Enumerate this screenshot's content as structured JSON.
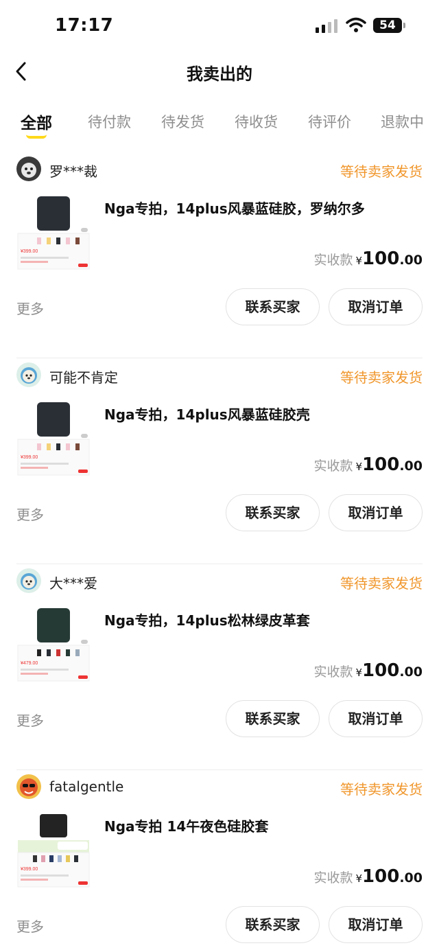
{
  "status_bar": {
    "time": "17:17",
    "battery": "54",
    "icons": [
      "signal-icon",
      "wifi-icon",
      "battery-icon"
    ]
  },
  "nav": {
    "title": "我卖出的",
    "back_icon": "chevron-left-icon"
  },
  "tabs": [
    {
      "label": "全部",
      "active": true
    },
    {
      "label": "待付款",
      "active": false
    },
    {
      "label": "待发货",
      "active": false
    },
    {
      "label": "待收货",
      "active": false
    },
    {
      "label": "待评价",
      "active": false
    },
    {
      "label": "退款中",
      "active": false
    }
  ],
  "colors": {
    "status_orange": "#f0962b",
    "tab_underline": "#ffd91a",
    "muted_gray": "#8e8e8e"
  },
  "orders": [
    {
      "buyer": "罗***裁",
      "status": "等待卖家发货",
      "title": "Nga专拍，14plus风暴蓝硅胶，罗纳尔多",
      "price_label": "实收款",
      "currency": "¥",
      "price_int": "100",
      "price_dec": ".00",
      "thumb_price": "¥399.00",
      "more": "更多",
      "contact": "联系买家",
      "cancel": "取消订单"
    },
    {
      "buyer": "可能不肯定",
      "status": "等待卖家发货",
      "title": "Nga专拍，14plus风暴蓝硅胶壳",
      "price_label": "实收款",
      "currency": "¥",
      "price_int": "100",
      "price_dec": ".00",
      "thumb_price": "¥399.00",
      "more": "更多",
      "contact": "联系买家",
      "cancel": "取消订单"
    },
    {
      "buyer": "大***爱",
      "status": "等待卖家发货",
      "title": "Nga专拍，14plus松林绿皮革套",
      "price_label": "实收款",
      "currency": "¥",
      "price_int": "100",
      "price_dec": ".00",
      "thumb_price": "¥479.00",
      "more": "更多",
      "contact": "联系买家",
      "cancel": "取消订单"
    },
    {
      "buyer": "fatalgentle",
      "status": "等待卖家发货",
      "title": "Nga专拍 14午夜色硅胶套",
      "price_label": "实收款",
      "currency": "¥",
      "price_int": "100",
      "price_dec": ".00",
      "thumb_price": "¥399.00",
      "more": "更多",
      "contact": "联系买家",
      "cancel": "取消订单"
    }
  ]
}
